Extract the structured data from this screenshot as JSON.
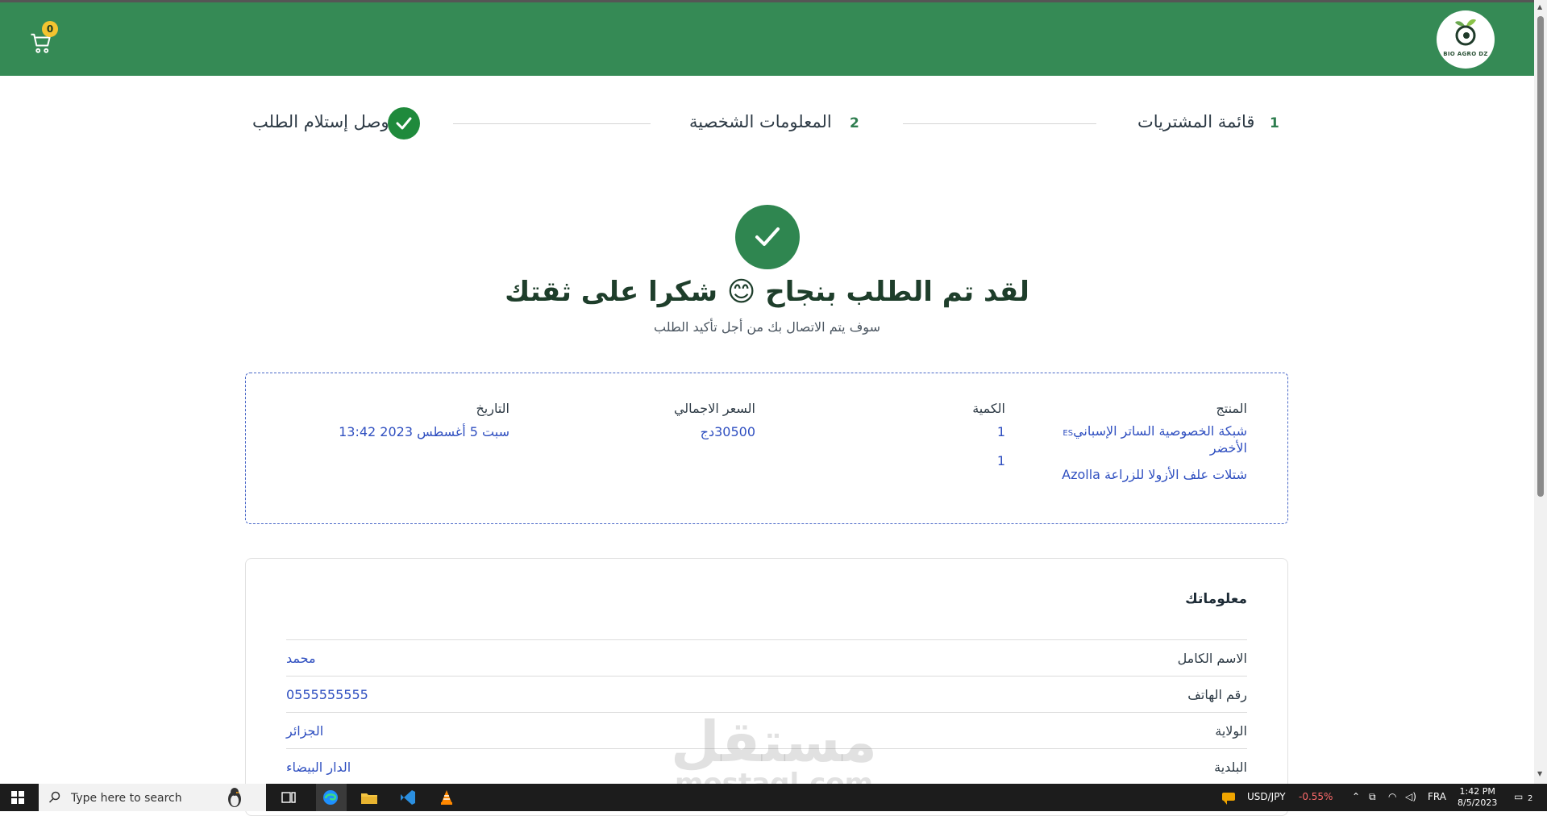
{
  "header": {
    "cart_count": "0",
    "logo_text": "BIO AGRO DZ"
  },
  "steps": [
    {
      "number": "1",
      "label": "قائمة المشتريات"
    },
    {
      "number": "2",
      "label": "المعلومات الشخصية"
    },
    {
      "label": "وصل إستلام الطلب"
    }
  ],
  "success": {
    "title": "لقد تم الطلب بنجاح 😊 شكرا على ثقتك",
    "subtitle": "سوف يتم الاتصال بك من أجل تأكيد الطلب"
  },
  "order": {
    "headers": {
      "product": "المنتج",
      "quantity": "الكمية",
      "total": "السعر الاجمالي",
      "date": "التاريخ"
    },
    "items": [
      {
        "product": "شبكة الخصوصية الساتر الإسباني",
        "product_suffix": "ES",
        "product_line2": "الأخضر",
        "quantity": "1"
      },
      {
        "product": "شتلات علف الأزولا للزراعة Azolla",
        "quantity": "1"
      }
    ],
    "total": "30500دج",
    "date": "سبت 5 أغسطس 2023 13:42"
  },
  "info": {
    "title": "معلوماتك",
    "rows": [
      {
        "label": "الاسم الكامل",
        "value": "محمد"
      },
      {
        "label": "رقم الهاتف",
        "value": "0555555555"
      },
      {
        "label": "الولاية",
        "value": "الجزائر"
      },
      {
        "label": "البلدية",
        "value": "الدار البيضاء"
      }
    ]
  },
  "watermark": {
    "line1": "مستقل",
    "line2": "mostaql.com"
  },
  "taskbar": {
    "search_placeholder": "Type here to search",
    "ticker_symbol": "USD/JPY",
    "ticker_change": "-0.55%",
    "language": "FRA",
    "time": "1:42 PM",
    "date": "8/5/2023",
    "notification_count": "2"
  },
  "colors": {
    "header_green": "#358a55",
    "success_green": "#2f8650",
    "link_blue": "#2f4fc0",
    "badge_yellow": "#f4c430"
  }
}
